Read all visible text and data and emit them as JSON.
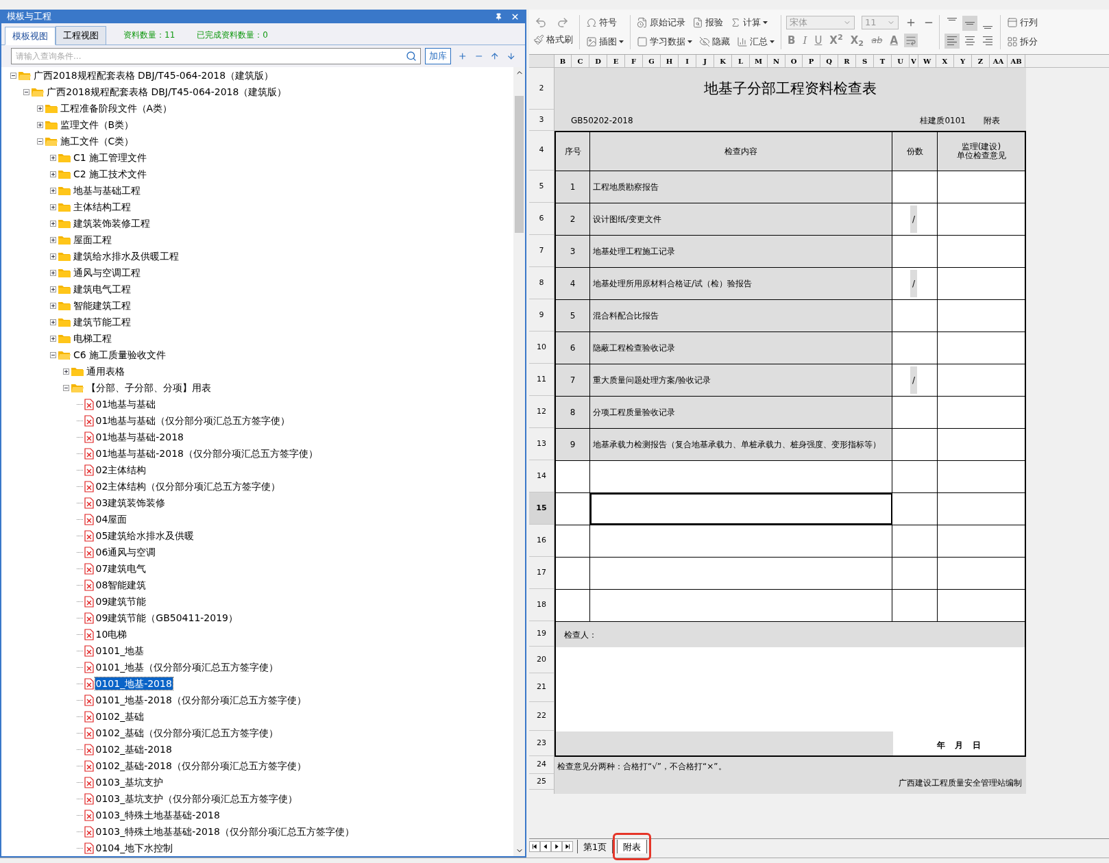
{
  "panel": {
    "title": "模板与工程",
    "tabs": [
      {
        "label": "模板视图",
        "selected": true
      },
      {
        "label": "工程视图",
        "selected": false
      }
    ],
    "stats": [
      "资料数量：11",
      "已完成资料数量：0"
    ],
    "search": {
      "placeholder": "请输入查询条件..."
    },
    "add_button": "加库",
    "tree": [
      {
        "kind": "folder",
        "label": "广西2018规程配套表格 DBJ/T45-064-2018（建筑版）",
        "expanded": true,
        "selected": false,
        "children": [
          {
            "kind": "folder",
            "label": "广西2018规程配套表格 DBJ/T45-064-2018（建筑版）",
            "expanded": true,
            "selected": false,
            "children": [
              {
                "kind": "folder",
                "label": "工程准备阶段文件（A类）",
                "expanded": false,
                "selected": false
              },
              {
                "kind": "folder",
                "label": "监理文件（B类）",
                "expanded": false,
                "selected": false
              },
              {
                "kind": "folder",
                "label": "施工文件（C类）",
                "expanded": true,
                "selected": false,
                "children": [
                  {
                    "kind": "folder",
                    "label": "C1 施工管理文件",
                    "expanded": false,
                    "selected": false
                  },
                  {
                    "kind": "folder",
                    "label": "C2 施工技术文件",
                    "expanded": false,
                    "selected": false
                  },
                  {
                    "kind": "folder",
                    "label": "地基与基础工程",
                    "expanded": false,
                    "selected": false
                  },
                  {
                    "kind": "folder",
                    "label": "主体结构工程",
                    "expanded": false,
                    "selected": false
                  },
                  {
                    "kind": "folder",
                    "label": "建筑装饰装修工程",
                    "expanded": false,
                    "selected": false
                  },
                  {
                    "kind": "folder",
                    "label": "屋面工程",
                    "expanded": false,
                    "selected": false
                  },
                  {
                    "kind": "folder",
                    "label": "建筑给水排水及供暖工程",
                    "expanded": false,
                    "selected": false
                  },
                  {
                    "kind": "folder",
                    "label": "通风与空调工程",
                    "expanded": false,
                    "selected": false
                  },
                  {
                    "kind": "folder",
                    "label": "建筑电气工程",
                    "expanded": false,
                    "selected": false
                  },
                  {
                    "kind": "folder",
                    "label": "智能建筑工程",
                    "expanded": false,
                    "selected": false
                  },
                  {
                    "kind": "folder",
                    "label": "建筑节能工程",
                    "expanded": false,
                    "selected": false
                  },
                  {
                    "kind": "folder",
                    "label": "电梯工程",
                    "expanded": false,
                    "selected": false
                  },
                  {
                    "kind": "folder",
                    "label": "C6 施工质量验收文件",
                    "expanded": true,
                    "selected": false,
                    "children": [
                      {
                        "kind": "folder",
                        "label": "通用表格",
                        "expanded": false,
                        "selected": false
                      },
                      {
                        "kind": "folder",
                        "label": "【分部、子分部、分项】用表",
                        "expanded": true,
                        "selected": false,
                        "children": [
                          {
                            "kind": "file",
                            "label": "01地基与基础",
                            "selected": false
                          },
                          {
                            "kind": "file",
                            "label": "01地基与基础（仅分部分项汇总五方签字使）",
                            "selected": false
                          },
                          {
                            "kind": "file",
                            "label": "01地基与基础-2018",
                            "selected": false
                          },
                          {
                            "kind": "file",
                            "label": "01地基与基础-2018（仅分部分项汇总五方签字使）",
                            "selected": false
                          },
                          {
                            "kind": "file",
                            "label": "02主体结构",
                            "selected": false
                          },
                          {
                            "kind": "file",
                            "label": "02主体结构（仅分部分项汇总五方签字使）",
                            "selected": false
                          },
                          {
                            "kind": "file",
                            "label": "03建筑装饰装修",
                            "selected": false
                          },
                          {
                            "kind": "file",
                            "label": "04屋面",
                            "selected": false
                          },
                          {
                            "kind": "file",
                            "label": "05建筑给水排水及供暖",
                            "selected": false
                          },
                          {
                            "kind": "file",
                            "label": "06通风与空调",
                            "selected": false
                          },
                          {
                            "kind": "file",
                            "label": "07建筑电气",
                            "selected": false
                          },
                          {
                            "kind": "file",
                            "label": "08智能建筑",
                            "selected": false
                          },
                          {
                            "kind": "file",
                            "label": "09建筑节能",
                            "selected": false
                          },
                          {
                            "kind": "file",
                            "label": "09建筑节能（GB50411-2019）",
                            "selected": false
                          },
                          {
                            "kind": "file",
                            "label": "10电梯",
                            "selected": false
                          },
                          {
                            "kind": "file",
                            "label": "0101_地基",
                            "selected": false
                          },
                          {
                            "kind": "file",
                            "label": "0101_地基（仅分部分项汇总五方签字使）",
                            "selected": false
                          },
                          {
                            "kind": "file",
                            "label": "0101_地基-2018",
                            "selected": true
                          },
                          {
                            "kind": "file",
                            "label": "0101_地基-2018（仅分部分项汇总五方签字使）",
                            "selected": false
                          },
                          {
                            "kind": "file",
                            "label": "0102_基础",
                            "selected": false
                          },
                          {
                            "kind": "file",
                            "label": "0102_基础（仅分部分项汇总五方签字使）",
                            "selected": false
                          },
                          {
                            "kind": "file",
                            "label": "0102_基础-2018",
                            "selected": false
                          },
                          {
                            "kind": "file",
                            "label": "0102_基础-2018（仅分部分项汇总五方签字使）",
                            "selected": false
                          },
                          {
                            "kind": "file",
                            "label": "0103_基坑支护",
                            "selected": false
                          },
                          {
                            "kind": "file",
                            "label": "0103_基坑支护（仅分部分项汇总五方签字使）",
                            "selected": false
                          },
                          {
                            "kind": "file",
                            "label": "0103_特殊土地基基础-2018",
                            "selected": false
                          },
                          {
                            "kind": "file",
                            "label": "0103_特殊土地基基础-2018（仅分部分项汇总五方签字使）",
                            "selected": false
                          },
                          {
                            "kind": "file",
                            "label": "0104_地下水控制",
                            "selected": false
                          }
                        ]
                      }
                    ]
                  }
                ]
              }
            ]
          }
        ]
      }
    ]
  },
  "toolbar": {
    "groups": [
      [
        {
          "label": "格式刷"
        }
      ],
      [
        {
          "label": "符号"
        },
        {
          "label": "插图",
          "dropdown": true
        }
      ],
      [
        {
          "label": "原始记录"
        },
        {
          "label": "报验"
        },
        {
          "label": "计算",
          "dropdown": true
        },
        {
          "label": "学习数据",
          "dropdown": true
        },
        {
          "label": "隐藏"
        },
        {
          "label": "汇总",
          "dropdown": true
        }
      ],
      [
        {
          "label": "行列"
        },
        {
          "label": "拆分"
        }
      ]
    ],
    "font": {
      "value": "宋体",
      "disabled": true
    },
    "size": {
      "value": "11",
      "disabled": true
    },
    "format": [
      "B",
      "I",
      "U",
      "X$^{2}$",
      "X$_{2}$",
      "ab",
      "A"
    ],
    "vertical_align": [
      {
        "selected": false
      },
      {
        "selected": true
      },
      {
        "selected": false
      }
    ],
    "horizontal_align": [
      {
        "selected": true
      },
      {
        "selected": false
      },
      {
        "selected": false
      }
    ],
    "wrap_text": {
      "selected": true
    }
  },
  "sheet": {
    "columns": [
      "B",
      "C",
      "D",
      "E",
      "F",
      "G",
      "H",
      "I",
      "J",
      "K",
      "L",
      "M",
      "N",
      "O",
      "P",
      "Q",
      "R",
      "S",
      "T",
      "U",
      "V",
      "W",
      "X",
      "Y",
      "Z",
      "AA",
      "AB"
    ],
    "row_numbers": [
      {
        "label": "2",
        "selected": false
      },
      {
        "label": "3",
        "selected": false
      },
      {
        "label": "4",
        "selected": false
      },
      {
        "label": "5",
        "selected": false
      },
      {
        "label": "6",
        "selected": false
      },
      {
        "label": "7",
        "selected": false
      },
      {
        "label": "8",
        "selected": false
      },
      {
        "label": "9",
        "selected": false
      },
      {
        "label": "10",
        "selected": false
      },
      {
        "label": "11",
        "selected": false
      },
      {
        "label": "12",
        "selected": false
      },
      {
        "label": "13",
        "selected": false
      },
      {
        "label": "14",
        "selected": false
      },
      {
        "label": "15",
        "selected": true
      },
      {
        "label": "16",
        "selected": false
      },
      {
        "label": "17",
        "selected": false
      },
      {
        "label": "18",
        "selected": false
      },
      {
        "label": "19",
        "selected": false
      },
      {
        "label": "20",
        "selected": false
      },
      {
        "label": "21",
        "selected": false
      },
      {
        "label": "22",
        "selected": false
      },
      {
        "label": "23",
        "selected": false
      },
      {
        "label": "24",
        "selected": false
      },
      {
        "label": "25",
        "selected": false
      }
    ],
    "title": "地基子分部工程资料检查表",
    "standard": "GB50202-2018",
    "form_code": "桂建质0101",
    "appendix": "附表",
    "header": [
      "序号",
      "检查内容",
      "份数",
      "监理(建设)\n单位检查意见"
    ],
    "rows": [
      {
        "kind": "item",
        "no": "1",
        "content": "工程地质勘察报告",
        "selected": false
      },
      {
        "kind": "item",
        "no": "2",
        "content": "设计图纸/变更文件",
        "copies": "/",
        "selected": false
      },
      {
        "kind": "item",
        "no": "3",
        "content": "地基处理工程施工记录",
        "selected": false
      },
      {
        "kind": "item",
        "no": "4",
        "content": "地基处理所用原材料合格证/试（检）验报告",
        "copies": "/",
        "selected": false
      },
      {
        "kind": "item",
        "no": "5",
        "content": "混合料配合比报告",
        "selected": false
      },
      {
        "kind": "item",
        "no": "6",
        "content": "隐蔽工程检查验收记录",
        "selected": false
      },
      {
        "kind": "item",
        "no": "7",
        "content": "重大质量问题处理方案/验收记录",
        "copies": "/",
        "selected": false
      },
      {
        "kind": "item",
        "no": "8",
        "content": "分项工程质量验收记录",
        "selected": false
      },
      {
        "kind": "item",
        "no": "9",
        "content": "地基承载力检测报告（复合地基承载力、单桩承载力、桩身强度、变形指标等）",
        "selected": false
      },
      {
        "kind": "blank",
        "selected": false
      },
      {
        "kind": "blank",
        "selected": true
      },
      {
        "kind": "blank",
        "selected": false
      },
      {
        "kind": "blank",
        "selected": false
      },
      {
        "kind": "blank",
        "selected": false
      }
    ],
    "inspector": "检查人：",
    "date": [
      "年",
      "月",
      "日"
    ],
    "note": "检查意见分两种：合格打“√”，不合格打“×”。",
    "footer": "广西建设工程质量安全管理站编制",
    "tabs": [
      {
        "label": "第1页",
        "selected": false,
        "highlighted": false
      },
      {
        "label": "附表",
        "selected": true,
        "highlighted": true
      }
    ]
  }
}
